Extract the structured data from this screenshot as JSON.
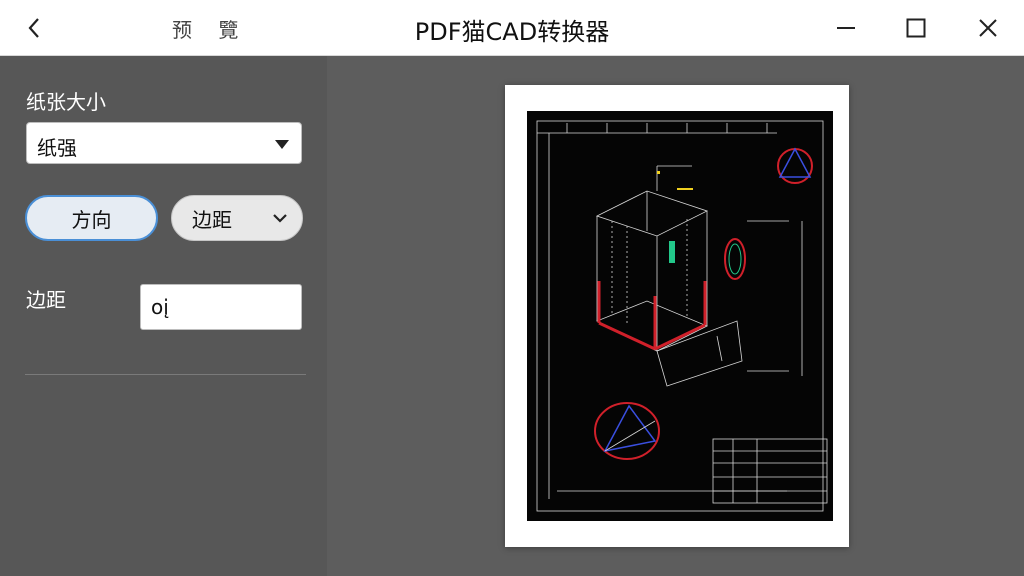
{
  "titlebar": {
    "nav_label": "预 覽",
    "app_title": "PDF猫CAD转换器"
  },
  "sidebar": {
    "paper_size_label": "纸张大小",
    "paper_size_value": "纸强",
    "orientation_button": "方向",
    "margin_button": "边距",
    "margin_label": "边距",
    "margin_input_value": "oį"
  },
  "icons": {
    "back": "chevron-left-icon",
    "minimize": "minimize-icon",
    "maximize": "maximize-icon",
    "close": "close-icon",
    "dropdown": "caret-down-icon",
    "chevron": "chevron-down-icon"
  },
  "colors": {
    "accent": "#4a8fd6",
    "sidebar_bg": "#575757",
    "preview_bg": "#5d5d5d",
    "cad_red": "#d0202a",
    "cad_green": "#22c88a",
    "cad_blue": "#3a4fe0",
    "cad_yellow": "#f0d020"
  }
}
